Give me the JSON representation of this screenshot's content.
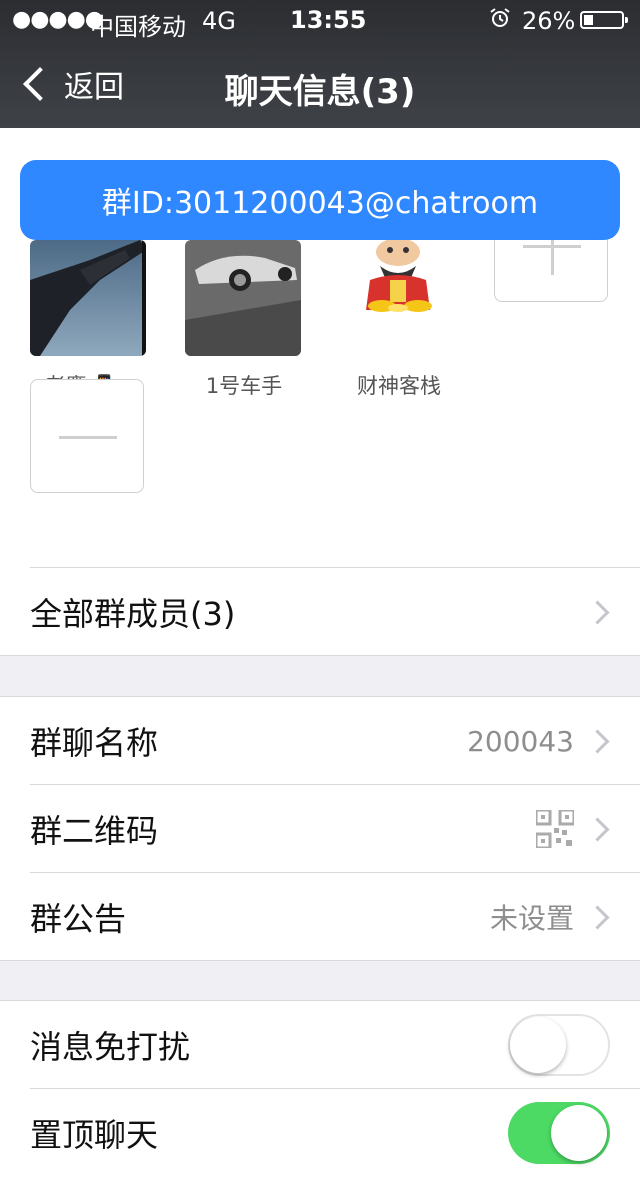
{
  "status_bar": {
    "signal_dots": "●●●●●",
    "carrier": "中国移动",
    "network": "4G",
    "time": "13:55",
    "battery_percent": "26%",
    "battery_level": 0.26
  },
  "nav": {
    "back_label": "返回",
    "title": "聊天信息(3)"
  },
  "group_id_banner": "群ID:3011200043@chatroom",
  "members": [
    {
      "name": "老鹰📲…",
      "avatar": "eagle-photo"
    },
    {
      "name": "1号车手",
      "avatar": "car-photo"
    },
    {
      "name": "财神客栈",
      "avatar": "fortune-god-cartoon"
    }
  ],
  "rows": {
    "all_members": "全部群成员(3)",
    "group_name_label": "群聊名称",
    "group_name_value": "200043",
    "qr_label": "群二维码",
    "notice_label": "群公告",
    "notice_value": "未设置",
    "mute_label": "消息免打扰",
    "mute_on": false,
    "pin_label": "置顶聊天",
    "pin_on": true
  },
  "colors": {
    "banner": "#2f88ff",
    "toggle_on": "#4cd964"
  }
}
